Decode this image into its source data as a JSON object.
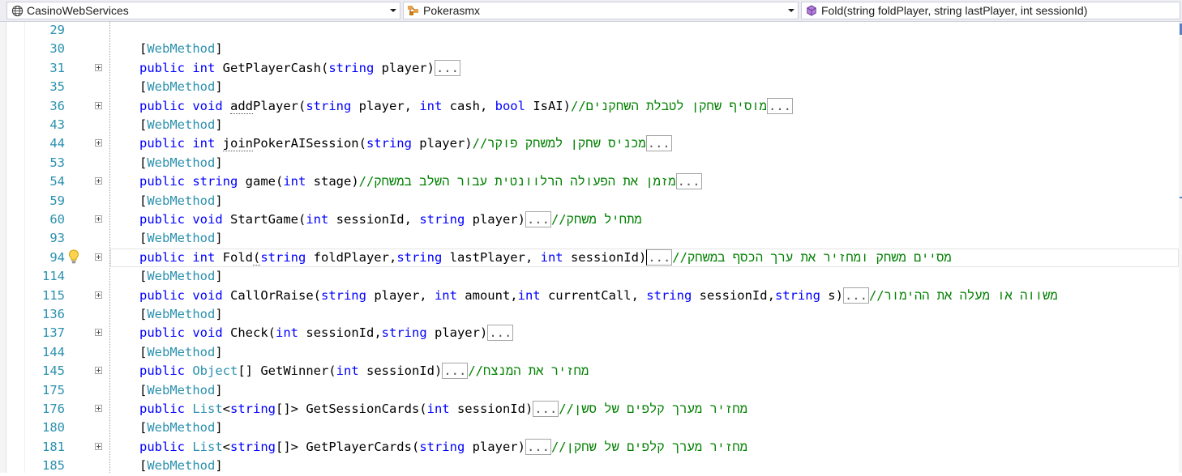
{
  "navbar": {
    "project": "CasinoWebServices",
    "class": "Pokerasmx",
    "member": "Fold(string foldPlayer, string lastPlayer, int sessionId)"
  },
  "lines": [
    {
      "n": "29",
      "tokens": []
    },
    {
      "n": "30",
      "tokens": [
        {
          "t": "[",
          "c": ""
        },
        {
          "t": "WebMethod",
          "c": "ty"
        },
        {
          "t": "]",
          "c": ""
        }
      ]
    },
    {
      "n": "31",
      "exp": true,
      "tokens": [
        {
          "t": "public ",
          "c": "kw"
        },
        {
          "t": "int ",
          "c": "kw"
        },
        {
          "t": "GetPlayerCash(",
          "c": ""
        },
        {
          "t": "string ",
          "c": "kw"
        },
        {
          "t": "player)",
          "c": ""
        },
        {
          "t": "...",
          "c": "box"
        }
      ]
    },
    {
      "n": "35",
      "tokens": [
        {
          "t": "[",
          "c": ""
        },
        {
          "t": "WebMethod",
          "c": "ty"
        },
        {
          "t": "]",
          "c": ""
        }
      ]
    },
    {
      "n": "36",
      "exp": true,
      "tokens": [
        {
          "t": "public ",
          "c": "kw"
        },
        {
          "t": "void ",
          "c": "kw"
        },
        {
          "t": "add",
          "c": "dotted"
        },
        {
          "t": "Player(",
          "c": ""
        },
        {
          "t": "string ",
          "c": "kw"
        },
        {
          "t": "player, ",
          "c": ""
        },
        {
          "t": "int ",
          "c": "kw"
        },
        {
          "t": "cash, ",
          "c": ""
        },
        {
          "t": "bool ",
          "c": "kw"
        },
        {
          "t": "IsAI)",
          "c": ""
        },
        {
          "t": "//מוסיף שחקן לטבלת השחקנים",
          "c": "cm"
        },
        {
          "t": "...",
          "c": "box"
        }
      ]
    },
    {
      "n": "43",
      "tokens": [
        {
          "t": "[",
          "c": ""
        },
        {
          "t": "WebMethod",
          "c": "ty"
        },
        {
          "t": "]",
          "c": ""
        }
      ]
    },
    {
      "n": "44",
      "exp": true,
      "tokens": [
        {
          "t": "public ",
          "c": "kw"
        },
        {
          "t": "int ",
          "c": "kw"
        },
        {
          "t": "join",
          "c": "dotted"
        },
        {
          "t": "PokerAISession(",
          "c": ""
        },
        {
          "t": "string ",
          "c": "kw"
        },
        {
          "t": "player)",
          "c": ""
        },
        {
          "t": "//מכניס שחקן למשחק פוקר",
          "c": "cm"
        },
        {
          "t": "...",
          "c": "box"
        }
      ]
    },
    {
      "n": "53",
      "tokens": [
        {
          "t": "[",
          "c": ""
        },
        {
          "t": "WebMethod",
          "c": "ty"
        },
        {
          "t": "]",
          "c": ""
        }
      ]
    },
    {
      "n": "54",
      "exp": true,
      "tokens": [
        {
          "t": "public ",
          "c": "kw"
        },
        {
          "t": "string ",
          "c": "kw"
        },
        {
          "t": "game(",
          "c": ""
        },
        {
          "t": "int ",
          "c": "kw"
        },
        {
          "t": "stage)",
          "c": ""
        },
        {
          "t": "//מזמן את הפעולה הרלוונטית עבור השלב במשחק",
          "c": "cm"
        },
        {
          "t": "...",
          "c": "box"
        }
      ]
    },
    {
      "n": "59",
      "tokens": [
        {
          "t": "[",
          "c": ""
        },
        {
          "t": "WebMethod",
          "c": "ty"
        },
        {
          "t": "]",
          "c": ""
        }
      ]
    },
    {
      "n": "60",
      "exp": true,
      "tokens": [
        {
          "t": "public ",
          "c": "kw"
        },
        {
          "t": "void ",
          "c": "kw"
        },
        {
          "t": "StartGame(",
          "c": ""
        },
        {
          "t": "int ",
          "c": "kw"
        },
        {
          "t": "sessionId, ",
          "c": ""
        },
        {
          "t": "string ",
          "c": "kw"
        },
        {
          "t": "player)",
          "c": ""
        },
        {
          "t": "...",
          "c": "box"
        },
        {
          "t": "//מתחיל משחק",
          "c": "cm"
        }
      ]
    },
    {
      "n": "93",
      "tokens": [
        {
          "t": "[",
          "c": ""
        },
        {
          "t": "WebMethod",
          "c": "ty"
        },
        {
          "t": "]",
          "c": ""
        }
      ]
    },
    {
      "n": "94",
      "exp": true,
      "bulb": true,
      "current": true,
      "tokens": [
        {
          "t": "public ",
          "c": "kw"
        },
        {
          "t": "int ",
          "c": "kw"
        },
        {
          "t": "Fold",
          "c": ""
        },
        {
          "t": "(",
          "c": "dotted"
        },
        {
          "t": "string ",
          "c": "kw"
        },
        {
          "t": "foldPlayer,",
          "c": ""
        },
        {
          "t": "string ",
          "c": "kw"
        },
        {
          "t": "lastPlayer, ",
          "c": ""
        },
        {
          "t": "int ",
          "c": "kw"
        },
        {
          "t": "sessionId)",
          "c": ""
        },
        {
          "t": "...",
          "c": "box caret"
        },
        {
          "t": "//מסיים משחק ומחזיר את ערך הכסף במשחק",
          "c": "cm"
        }
      ]
    },
    {
      "n": "114",
      "tokens": [
        {
          "t": "[",
          "c": ""
        },
        {
          "t": "WebMethod",
          "c": "ty"
        },
        {
          "t": "]",
          "c": ""
        }
      ]
    },
    {
      "n": "115",
      "exp": true,
      "tokens": [
        {
          "t": "public ",
          "c": "kw"
        },
        {
          "t": "void ",
          "c": "kw"
        },
        {
          "t": "CallOrRaise(",
          "c": ""
        },
        {
          "t": "string ",
          "c": "kw"
        },
        {
          "t": "player, ",
          "c": ""
        },
        {
          "t": "int ",
          "c": "kw"
        },
        {
          "t": "amount,",
          "c": ""
        },
        {
          "t": "int ",
          "c": "kw"
        },
        {
          "t": "currentCall, ",
          "c": ""
        },
        {
          "t": "string ",
          "c": "kw"
        },
        {
          "t": "sessionId,",
          "c": ""
        },
        {
          "t": "string ",
          "c": "kw"
        },
        {
          "t": "s)",
          "c": ""
        },
        {
          "t": "...",
          "c": "box"
        },
        {
          "t": "//משווה או מעלה את ההימור",
          "c": "cm"
        }
      ]
    },
    {
      "n": "136",
      "tokens": [
        {
          "t": "[",
          "c": ""
        },
        {
          "t": "WebMethod",
          "c": "ty"
        },
        {
          "t": "]",
          "c": ""
        }
      ]
    },
    {
      "n": "137",
      "exp": true,
      "tokens": [
        {
          "t": "public ",
          "c": "kw"
        },
        {
          "t": "void ",
          "c": "kw"
        },
        {
          "t": "Check(",
          "c": ""
        },
        {
          "t": "int ",
          "c": "kw"
        },
        {
          "t": "sessionId,",
          "c": ""
        },
        {
          "t": "string ",
          "c": "kw"
        },
        {
          "t": "player)",
          "c": ""
        },
        {
          "t": "...",
          "c": "box"
        }
      ]
    },
    {
      "n": "144",
      "tokens": [
        {
          "t": "[",
          "c": ""
        },
        {
          "t": "WebMethod",
          "c": "ty"
        },
        {
          "t": "]",
          "c": ""
        }
      ]
    },
    {
      "n": "145",
      "exp": true,
      "tokens": [
        {
          "t": "public ",
          "c": "kw"
        },
        {
          "t": "Object",
          "c": "ty"
        },
        {
          "t": "[] GetWinner(",
          "c": ""
        },
        {
          "t": "int ",
          "c": "kw"
        },
        {
          "t": "sessionId)",
          "c": ""
        },
        {
          "t": "...",
          "c": "box"
        },
        {
          "t": "//מחזיר את המנצח",
          "c": "cm"
        }
      ]
    },
    {
      "n": "175",
      "tokens": [
        {
          "t": "[",
          "c": ""
        },
        {
          "t": "WebMethod",
          "c": "ty"
        },
        {
          "t": "]",
          "c": ""
        }
      ]
    },
    {
      "n": "176",
      "exp": true,
      "tokens": [
        {
          "t": "public ",
          "c": "kw"
        },
        {
          "t": "List",
          "c": "ty"
        },
        {
          "t": "<",
          "c": ""
        },
        {
          "t": "string",
          "c": "kw"
        },
        {
          "t": "[]> GetSessionCards(",
          "c": ""
        },
        {
          "t": "int ",
          "c": "kw"
        },
        {
          "t": "sessionId)",
          "c": ""
        },
        {
          "t": "...",
          "c": "box"
        },
        {
          "t": "//מחזיר מערך קלפים של סשן",
          "c": "cm"
        }
      ]
    },
    {
      "n": "180",
      "tokens": [
        {
          "t": "[",
          "c": ""
        },
        {
          "t": "WebMethod",
          "c": "ty"
        },
        {
          "t": "]",
          "c": ""
        }
      ]
    },
    {
      "n": "181",
      "exp": true,
      "tokens": [
        {
          "t": "public ",
          "c": "kw"
        },
        {
          "t": "List",
          "c": "ty"
        },
        {
          "t": "<",
          "c": ""
        },
        {
          "t": "string",
          "c": "kw"
        },
        {
          "t": "[]> GetPlayerCards(",
          "c": ""
        },
        {
          "t": "string ",
          "c": "kw"
        },
        {
          "t": "player)",
          "c": ""
        },
        {
          "t": "...",
          "c": "box"
        },
        {
          "t": "//מחזיר מערך קלפים של שחקן",
          "c": "cm"
        }
      ]
    },
    {
      "n": "185",
      "tokens": [
        {
          "t": "[",
          "c": ""
        },
        {
          "t": "WebMethod",
          "c": "ty"
        },
        {
          "t": "]",
          "c": ""
        }
      ]
    }
  ]
}
